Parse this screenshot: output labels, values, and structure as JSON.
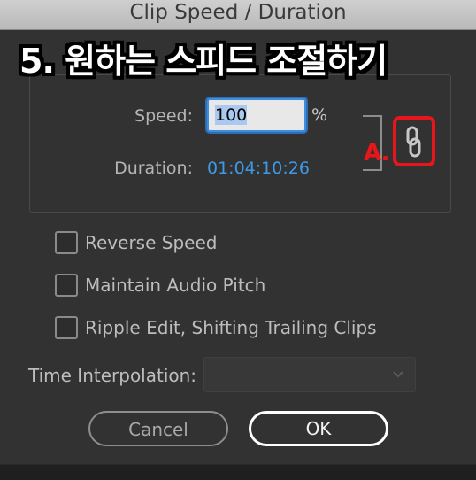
{
  "window": {
    "title": "Clip Speed / Duration"
  },
  "overlay": {
    "banner_text": "5. 원하는 스피드 조절하기",
    "annotation_letter": "A."
  },
  "speed": {
    "label": "Speed:",
    "value": "100",
    "unit": "%"
  },
  "duration": {
    "label": "Duration:",
    "value": "01:04:10:26"
  },
  "options": [
    {
      "label": "Reverse Speed",
      "checked": false
    },
    {
      "label": "Maintain Audio Pitch",
      "checked": false
    },
    {
      "label": "Ripple Edit, Shifting Trailing Clips",
      "checked": false
    }
  ],
  "time_interpolation": {
    "label": "Time Interpolation:",
    "value": ""
  },
  "buttons": {
    "cancel": "Cancel",
    "ok": "OK"
  },
  "colors": {
    "dialog_bg": "#323232",
    "timecode_blue": "#3d9ae8",
    "annotation_red": "#e8161b",
    "input_focus": "#3e8ee0"
  },
  "icons": {
    "link": "link-chain-icon",
    "dropdown": "chevron-down-icon"
  }
}
